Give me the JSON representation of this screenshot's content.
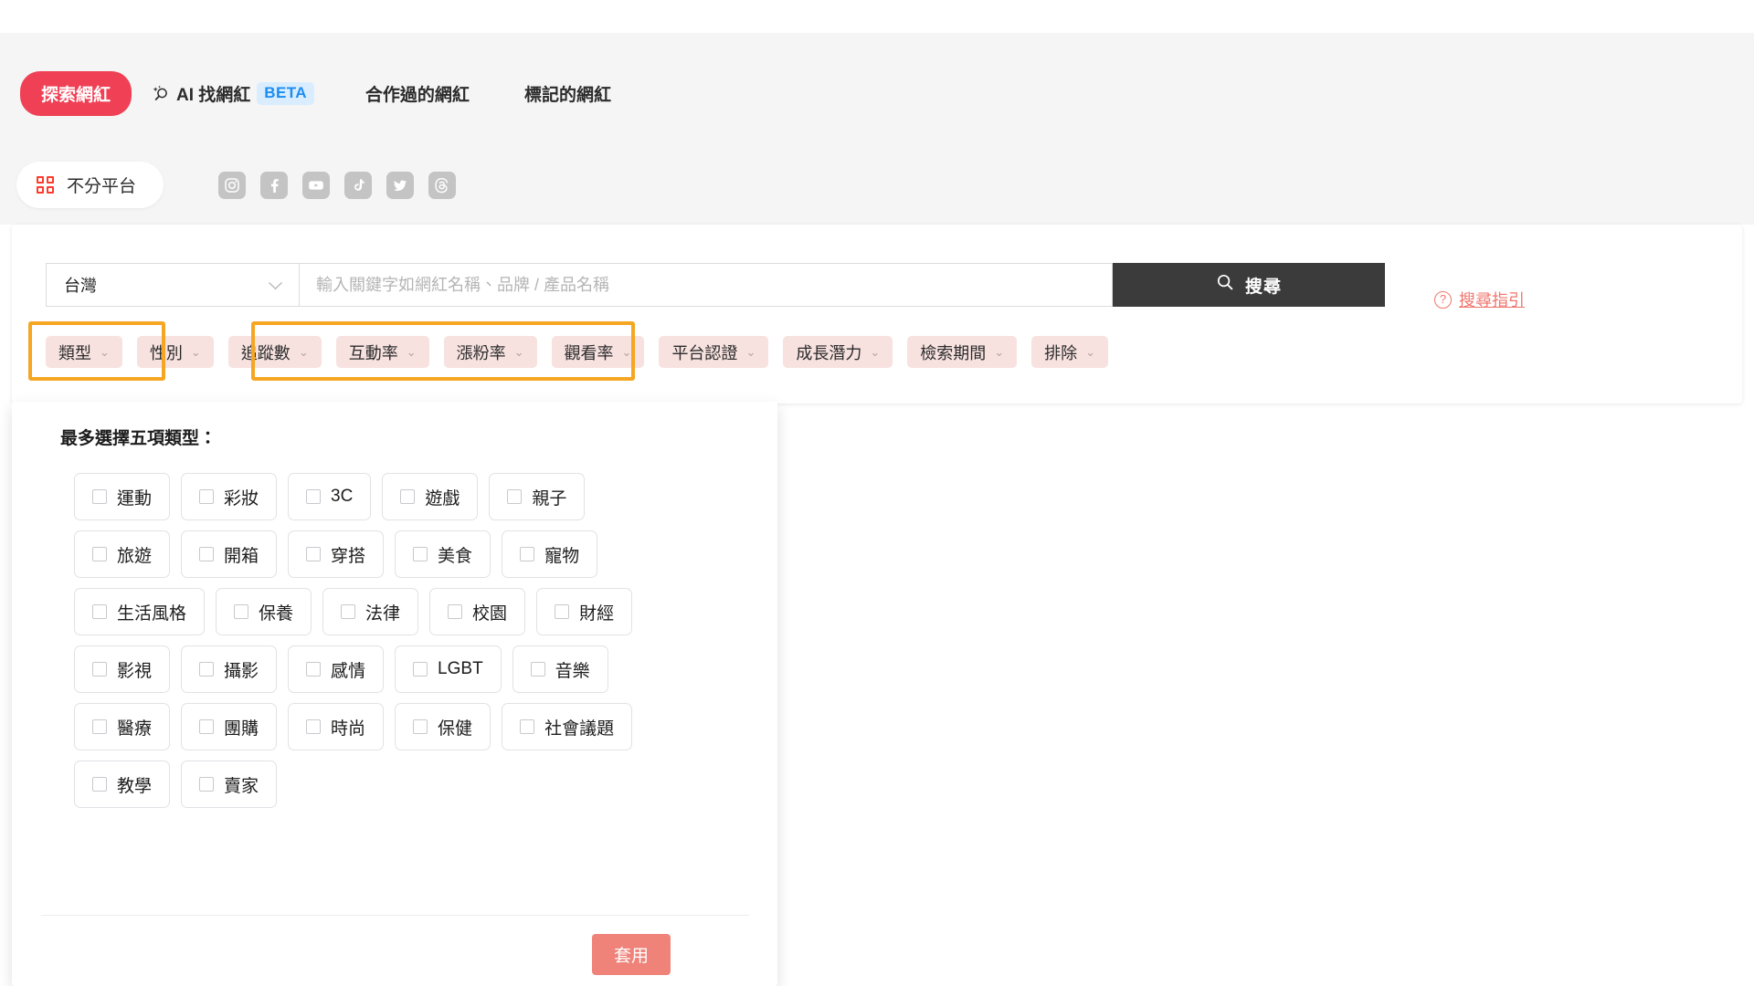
{
  "nav": {
    "tabs": [
      {
        "label": "探索網紅",
        "kind": "pill"
      },
      {
        "label": "AI 找網紅",
        "kind": "ai",
        "badge": "BETA",
        "icon": "ai-sparkle-search-icon"
      },
      {
        "label": "合作過的網紅",
        "kind": "plain"
      },
      {
        "label": "標記的網紅",
        "kind": "plain"
      }
    ]
  },
  "platforms": {
    "all_label": "不分平台",
    "all_icon": "grid-icon",
    "items": [
      {
        "name": "instagram",
        "icon": "instagram-icon"
      },
      {
        "name": "facebook",
        "icon": "facebook-icon"
      },
      {
        "name": "youtube",
        "icon": "youtube-icon"
      },
      {
        "name": "tiktok",
        "icon": "tiktok-icon"
      },
      {
        "name": "twitter",
        "icon": "twitter-icon"
      },
      {
        "name": "threads",
        "icon": "threads-icon"
      }
    ]
  },
  "search": {
    "country_value": "台灣",
    "keyword_value": "",
    "keyword_placeholder": "輸入關鍵字如網紅名稱、品牌 / 產品名稱",
    "button_label": "搜尋",
    "button_icon": "search-icon",
    "guide_label": "搜尋指引",
    "guide_icon": "question-circle-icon"
  },
  "filters": {
    "chips": [
      {
        "label": "類型",
        "highlighted": true
      },
      {
        "label": "性別",
        "highlighted": false
      },
      {
        "label": "追蹤數",
        "highlighted": true
      },
      {
        "label": "互動率",
        "highlighted": true
      },
      {
        "label": "漲粉率",
        "highlighted": true
      },
      {
        "label": "觀看率",
        "highlighted": false
      },
      {
        "label": "平台認證",
        "highlighted": false
      },
      {
        "label": "成長潛力",
        "highlighted": false
      },
      {
        "label": "檢索期間",
        "highlighted": false
      },
      {
        "label": "排除",
        "highlighted": false
      }
    ]
  },
  "panel": {
    "title": "最多選擇五項類型：",
    "apply_label": "套用",
    "rows": [
      [
        "運動",
        "彩妝",
        "3C",
        "遊戲",
        "親子"
      ],
      [
        "旅遊",
        "開箱",
        "穿搭",
        "美食",
        "寵物"
      ],
      [
        "生活風格",
        "保養",
        "法律",
        "校園",
        "財經"
      ],
      [
        "影視",
        "攝影",
        "感情",
        "LGBT",
        "音樂"
      ],
      [
        "醫療",
        "團購",
        "時尚",
        "保健",
        "社會議題"
      ],
      [
        "教學",
        "賣家"
      ]
    ]
  },
  "colors": {
    "accent_pill": "#ef4055",
    "chip_bg": "#f7e2e0",
    "apply_bg": "#ef8279",
    "annotation": "#f5a623",
    "beta_text": "#1b8df0",
    "search_btn_bg": "#3b3b3b"
  }
}
